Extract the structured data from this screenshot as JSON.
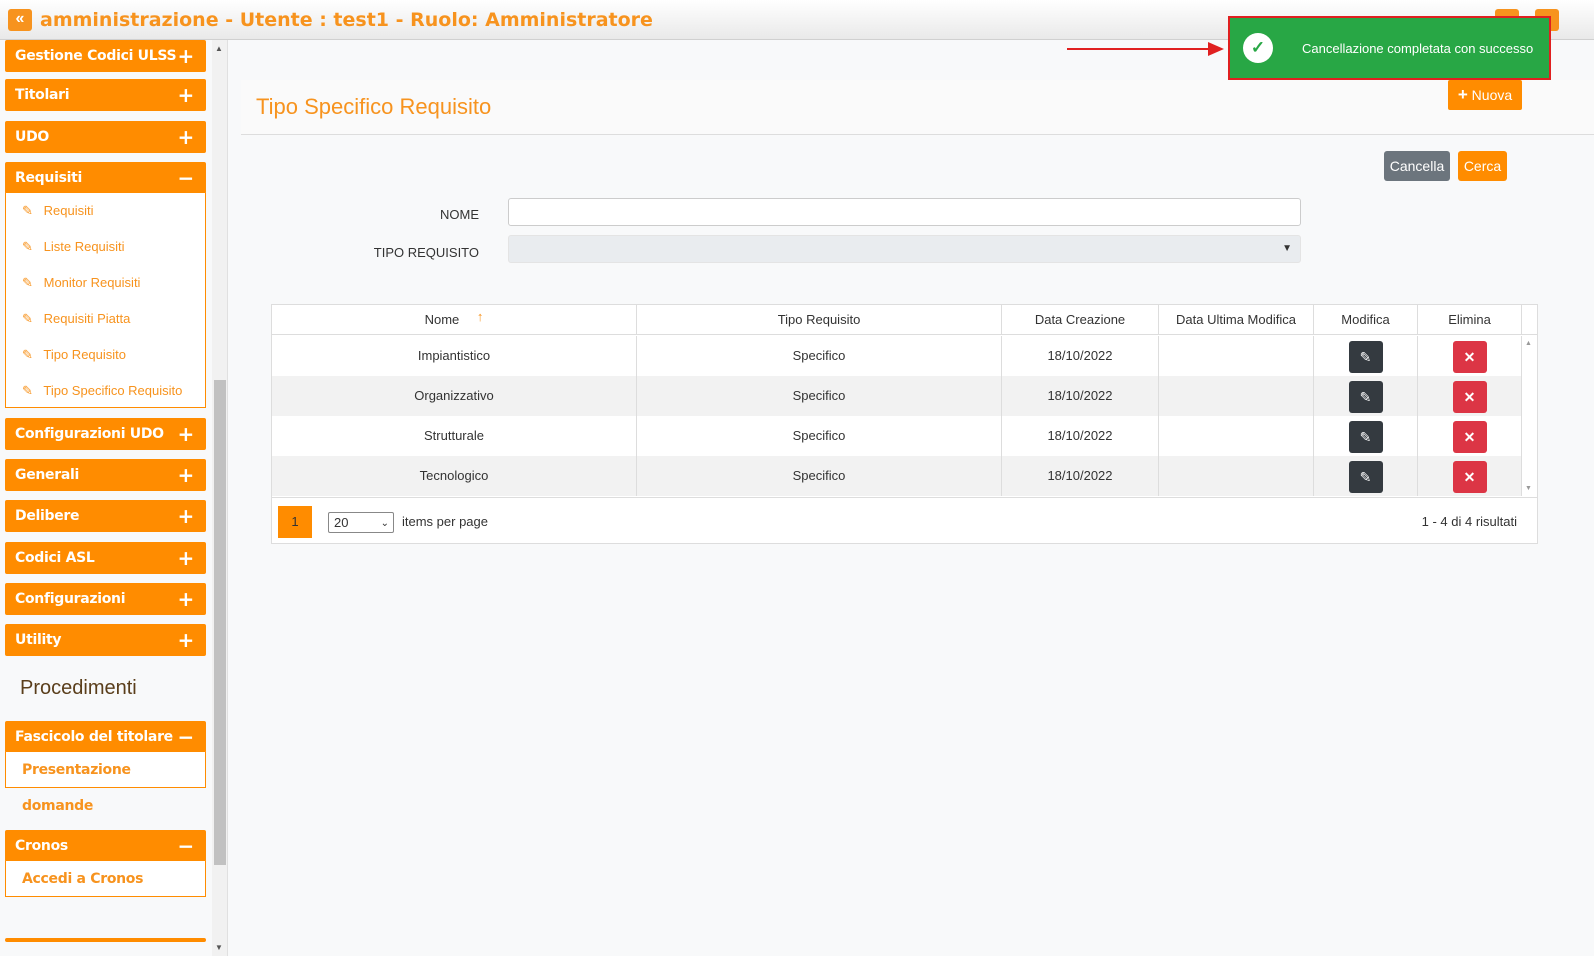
{
  "header": {
    "collapse_icon": "«",
    "title": "amministrazione - Utente : test1 - Ruolo: Amministratore"
  },
  "sidebar": {
    "menus": [
      {
        "label": "Gestione Codici ULSS",
        "sign": "+"
      },
      {
        "label": "Titolari",
        "sign": "+"
      },
      {
        "label": "UDO",
        "sign": "+"
      },
      {
        "label": "Requisiti",
        "sign": "−"
      },
      {
        "label": "Configurazioni UDO",
        "sign": "+"
      },
      {
        "label": "Generali",
        "sign": "+"
      },
      {
        "label": "Delibere",
        "sign": "+"
      },
      {
        "label": "Codici ASL",
        "sign": "+"
      },
      {
        "label": "Configurazioni",
        "sign": "+"
      },
      {
        "label": "Utility",
        "sign": "+"
      }
    ],
    "requisiti_items": [
      {
        "label": "Requisiti"
      },
      {
        "label": "Liste Requisiti"
      },
      {
        "label": "Monitor Requisiti"
      },
      {
        "label": "Requisiti Piatta"
      },
      {
        "label": "Tipo Requisito"
      },
      {
        "label": "Tipo Specifico Requisito"
      }
    ],
    "section_title": "Procedimenti",
    "fascicolo": {
      "label": "Fascicolo del titolare",
      "sign": "−",
      "item": "Presentazione domande"
    },
    "cronos": {
      "label": "Cronos",
      "sign": "−",
      "item": "Accedi a Cronos"
    }
  },
  "page": {
    "title": "Tipo Specifico Requisito",
    "new_button": "Nuova",
    "cancel_button": "Cancella",
    "search_button": "Cerca"
  },
  "filters": {
    "name_label": "NOME",
    "name_value": "",
    "type_label": "TIPO REQUISITO",
    "type_value": ""
  },
  "table": {
    "columns": [
      "Nome",
      "Tipo Requisito",
      "Data Creazione",
      "Data Ultima Modifica",
      "Modifica",
      "Elimina"
    ],
    "sort_indicator": "↑",
    "rows": [
      {
        "nome": "Impiantistico",
        "tipo": "Specifico",
        "creazione": "18/10/2022",
        "modifica": ""
      },
      {
        "nome": "Organizzativo",
        "tipo": "Specifico",
        "creazione": "18/10/2022",
        "modifica": ""
      },
      {
        "nome": "Strutturale",
        "tipo": "Specifico",
        "creazione": "18/10/2022",
        "modifica": ""
      },
      {
        "nome": "Tecnologico",
        "tipo": "Specifico",
        "creazione": "18/10/2022",
        "modifica": ""
      }
    ]
  },
  "pager": {
    "current_page": "1",
    "page_size": "20",
    "items_per_page_label": "items per page",
    "info": "1 - 4 di 4 risultati"
  },
  "toast": {
    "message": "Cancellazione completata con successo",
    "color": "#28a745"
  },
  "colors": {
    "accent": "#ff8c00",
    "danger": "#dc3545",
    "dark": "#343a40",
    "annotation": "#e02020"
  }
}
